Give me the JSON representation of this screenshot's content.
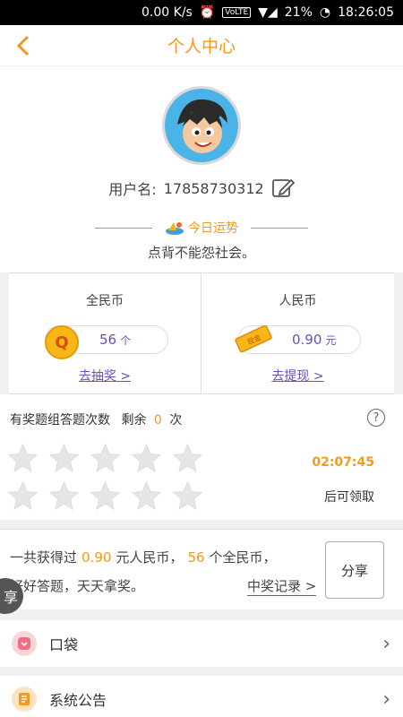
{
  "status_bar": {
    "speed": "0.00 K/s",
    "volte": "VoLTE",
    "battery": "21%",
    "time": "18:26:05"
  },
  "header": {
    "back_icon": "chevron-left-icon",
    "title": "个人中心"
  },
  "profile": {
    "username_label": "用户名:",
    "username": "17858730312",
    "fortune_title": "今日运势",
    "fortune_text": "点背不能怨社会。"
  },
  "coins": {
    "national": {
      "title": "全民币",
      "value": "56",
      "unit": "个",
      "badge": "Q",
      "link": "去抽奖 >"
    },
    "rmb": {
      "title": "人民币",
      "value": "0.90",
      "unit": "元",
      "badge": "现金",
      "link": "去提现 >"
    }
  },
  "quiz": {
    "label": "有奖题组答题次数",
    "remaining_label": "剩余",
    "remaining": "0",
    "unit": "次",
    "help": "?",
    "star_count": 10,
    "countdown": "02:07:45",
    "after_label": "后可领取"
  },
  "summary": {
    "prefix": "一共获得过",
    "rmb": "0.90",
    "rmb_unit": "元人民币，",
    "coins": "56",
    "coins_unit": "个全民币，",
    "line2": "好好答题，天天拿奖。",
    "records": "中奖记录 >",
    "share": "分享",
    "float_share": "享"
  },
  "menu": [
    {
      "label": "口袋",
      "icon": "pocket-icon",
      "color": "#f26d7d"
    },
    {
      "label": "系统公告",
      "icon": "notice-icon",
      "color": "#f39a1e"
    }
  ],
  "colors": {
    "accent": "#f39a1e",
    "link": "#6d4fb8"
  }
}
